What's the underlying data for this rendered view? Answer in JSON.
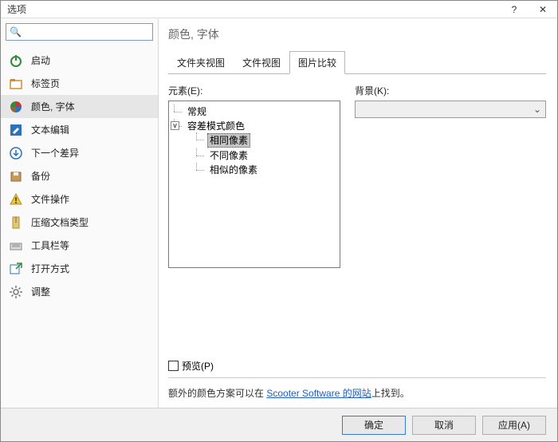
{
  "window": {
    "title": "选项",
    "help": "?",
    "close": "✕"
  },
  "search": {
    "placeholder": "🔍"
  },
  "sidebar": {
    "items": [
      {
        "label": "启动"
      },
      {
        "label": "标签页"
      },
      {
        "label": "颜色, 字体"
      },
      {
        "label": "文本编辑"
      },
      {
        "label": "下一个差异"
      },
      {
        "label": "备份"
      },
      {
        "label": "文件操作"
      },
      {
        "label": "压缩文档类型"
      },
      {
        "label": "工具栏等"
      },
      {
        "label": "打开方式"
      },
      {
        "label": "调整"
      }
    ],
    "selectedIndex": 2
  },
  "main": {
    "title": "颜色, 字体",
    "tabs": [
      {
        "label": "文件夹视图"
      },
      {
        "label": "文件视图"
      },
      {
        "label": "图片比较"
      }
    ],
    "activeTab": 2,
    "elementLabel": "元素(E):",
    "tree": {
      "root": {
        "label": "常规"
      },
      "group": {
        "label": "容差模式颜色",
        "expanded": true
      },
      "children": [
        {
          "label": "相同像素",
          "selected": true
        },
        {
          "label": "不同像素"
        },
        {
          "label": "相似的像素"
        }
      ]
    },
    "backgroundLabel": "背景(K):",
    "previewLabel": "预览(P)",
    "footerPrefix": "额外的颜色方案可以在 ",
    "footerLink": "Scooter Software 的网站",
    "footerSuffix": "上找到。"
  },
  "buttons": {
    "ok": "确定",
    "cancel": "取消",
    "apply": "应用(A)"
  }
}
